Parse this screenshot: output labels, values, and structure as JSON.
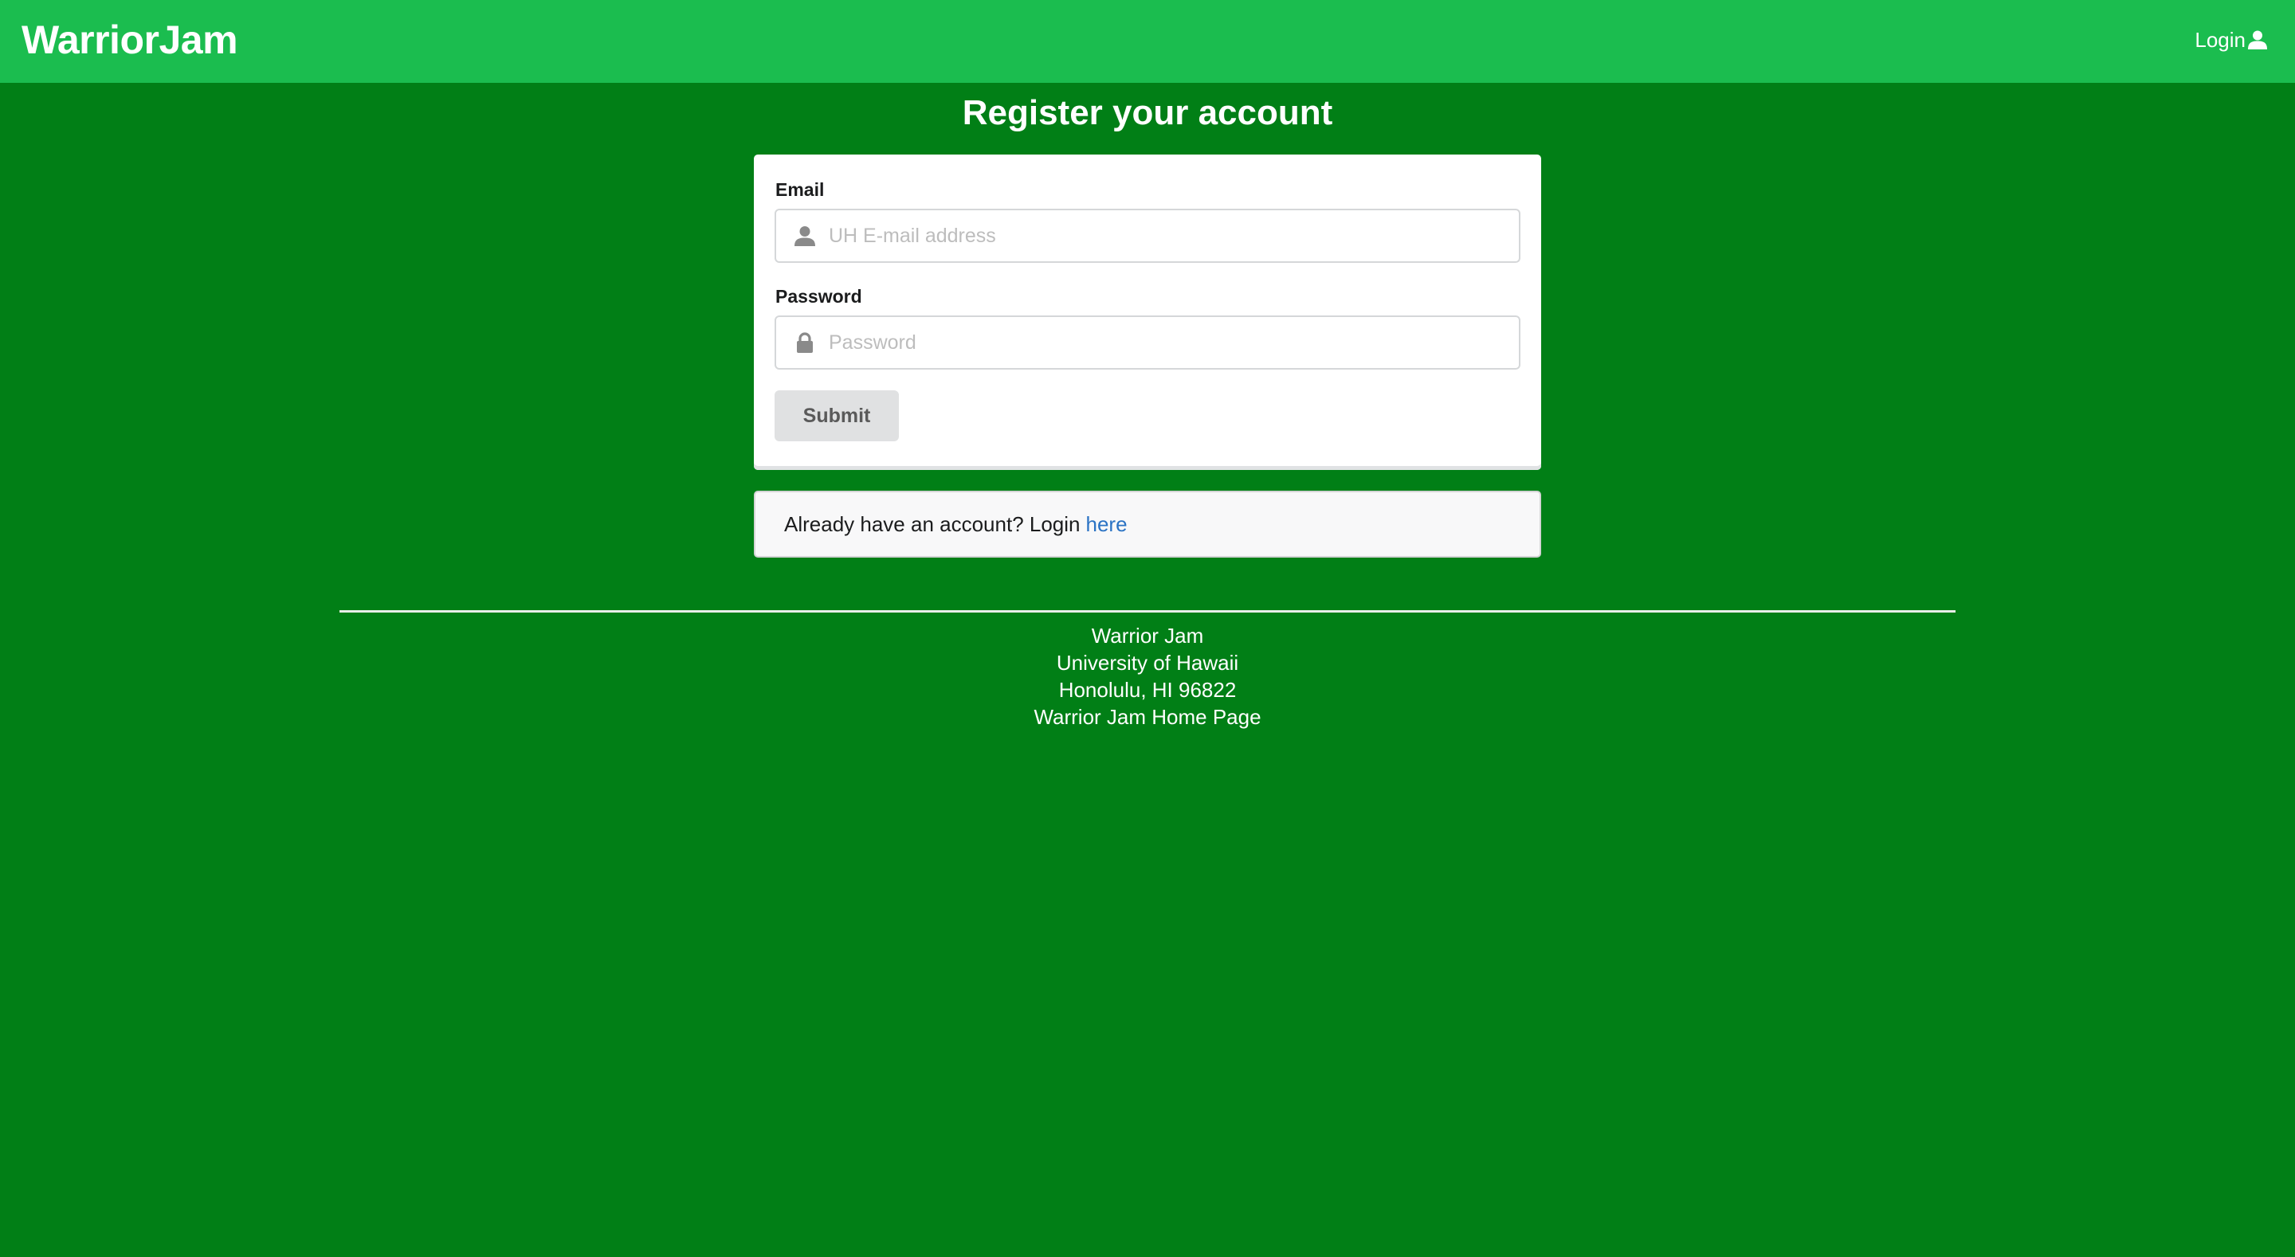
{
  "navbar": {
    "brand": "WarriorJam",
    "login_label": "Login",
    "login_icon": "user-icon"
  },
  "page": {
    "title": "Register your account"
  },
  "form": {
    "email": {
      "label": "Email",
      "placeholder": "UH E-mail address",
      "value": "",
      "icon": "user-icon"
    },
    "password": {
      "label": "Password",
      "placeholder": "Password",
      "value": "",
      "icon": "lock-icon"
    },
    "submit_label": "Submit"
  },
  "login_message": {
    "text": "Already have an account? Login",
    "link_text": "here"
  },
  "footer": {
    "lines": [
      "Warrior Jam",
      "University of Hawaii",
      "Honolulu, HI 96822",
      "Warrior Jam Home Page"
    ]
  },
  "colors": {
    "page_background": "#017f16",
    "navbar_background": "#1bbd4f",
    "link": "#2b73c4",
    "button_background": "#e0e1e2"
  }
}
